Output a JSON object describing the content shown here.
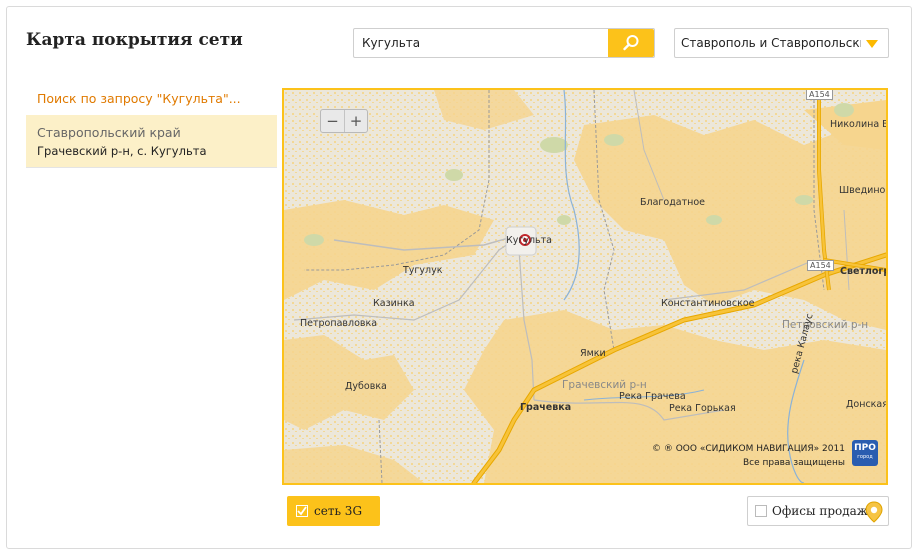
{
  "header": {
    "title": "Карта покрытия сети"
  },
  "search": {
    "value": "Кугульта",
    "button_icon": "search-icon"
  },
  "region_select": {
    "selected": "Ставрополь и Ставропольский",
    "icon": "chevron-down-icon"
  },
  "results": {
    "query_link": "Поиск по запросу \"Кугульта\"...",
    "items": [
      {
        "region": "Ставропольский край",
        "locality": "Грачевский р-н, с. Кугульта"
      }
    ]
  },
  "map": {
    "zoom_out": "−",
    "zoom_in": "+",
    "labels": {
      "kugulta": "Кугульта",
      "tugulyuk": "Тугулук",
      "kazinka": "Казинка",
      "petropavlovka": "Петропавловка",
      "dubovka": "Дубовка",
      "blagodatnoe": "Благодатное",
      "konstantinovskoe": "Константиновское",
      "yamki": "Ямки",
      "grachevka": "Грачевка",
      "grachevsky_district": "Грачевский р-н",
      "petrovsky_district": "Петровский р-н",
      "svetlograd": "Светлоград",
      "nikolina_balka": "Николина Б",
      "shvedino": "Шведино",
      "donskaya": "Донская",
      "reka_gracheva": "Река Грачева",
      "reka_gorkaya": "Река Горькая",
      "reka_kalaus": "река Калаус",
      "road_a154_top": "А154",
      "road_a154_right": "А154"
    },
    "copyright_line1": "© ® ООО «СИДИКОМ НАВИГАЦИЯ» 2011",
    "copyright_line2": "Все права защищены",
    "logo_text": "ПРО",
    "logo_sub": "город",
    "coverage_color": "#f6d58e",
    "road_color": "#f5b400"
  },
  "controls": {
    "network_3g": {
      "label": "сеть 3G",
      "checked": true
    },
    "sales_offices": {
      "label": "Офисы продаж",
      "checked": false,
      "icon": "map-pin-icon"
    }
  },
  "colors": {
    "accent": "#fcc21a",
    "link": "#e07a00",
    "selected_row": "#fcf0c8"
  }
}
